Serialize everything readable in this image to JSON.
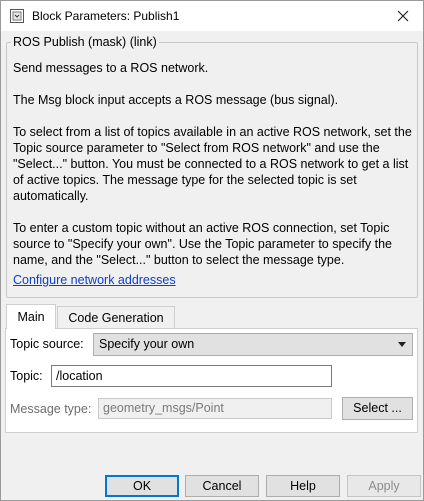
{
  "window": {
    "title": "Block Parameters: Publish1",
    "icons": {
      "app": "matlab-block-icon",
      "close": "close-icon"
    }
  },
  "mask": {
    "legend": "ROS Publish (mask) (link)",
    "description": [
      "Send messages to a ROS network.",
      "The Msg block input accepts a ROS message (bus signal).",
      "To select from a list of topics available in an active ROS network, set the Topic source parameter to \"Select from ROS network\" and use the \"Select...\" button. You must be connected to a ROS network to get a list of active topics. The message type for the selected topic is set automatically.",
      "To enter a custom topic without an active ROS connection, set Topic source to \"Specify your own\". Use the Topic parameter to specify the name, and the \"Select...\" button to select the message type."
    ],
    "link": "Configure network addresses"
  },
  "tabs": [
    {
      "label": "Main",
      "active": true
    },
    {
      "label": "Code Generation",
      "active": false
    }
  ],
  "main": {
    "topic_source_label": "Topic source:",
    "topic_source_value": "Specify your own",
    "topic_label": "Topic:",
    "topic_value": "/location",
    "message_type_label": "Message type:",
    "message_type_value": "geometry_msgs/Point",
    "select_button": "Select ..."
  },
  "footer": {
    "ok": "OK",
    "cancel": "Cancel",
    "help": "Help",
    "apply": "Apply"
  },
  "colors": {
    "link": "#0b3ec9",
    "default_button_border": "#0078d7",
    "background": "#f0f0f0"
  }
}
